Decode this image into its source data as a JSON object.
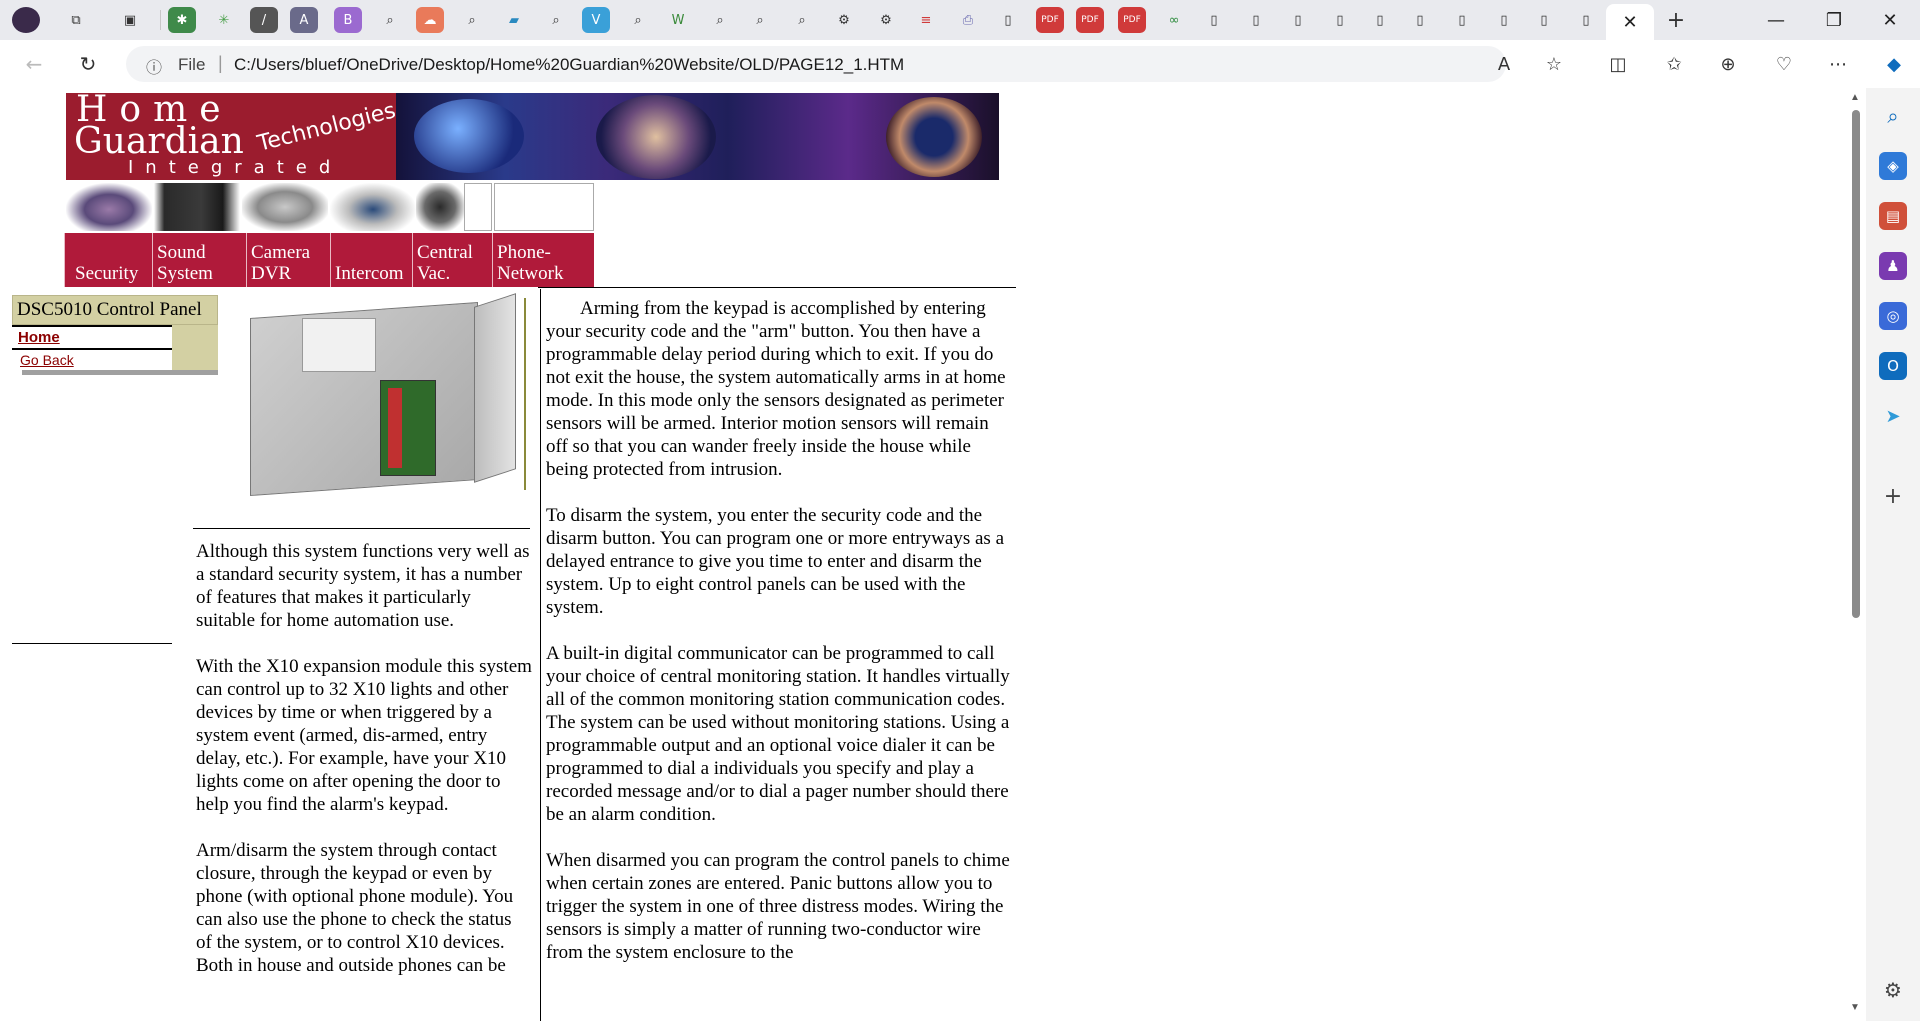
{
  "browser": {
    "window_controls": {
      "minimize": "—",
      "restore": "❐",
      "close": "✕"
    },
    "active_tab_close": "✕",
    "new_tab": "+",
    "address": {
      "info_icon": "ⓘ",
      "scheme_label": "File",
      "url": "C:/Users/bluef/OneDrive/Desktop/Home%20Guardian%20Website/OLD/PAGE12_1.HTM"
    },
    "accent": "#0f6cbd"
  },
  "banner": {
    "home": "Home",
    "guardian": "Guardian",
    "technologies": "Technologies",
    "integrated": "Integrated"
  },
  "nav": {
    "items": [
      {
        "line1": "",
        "line2": "Security"
      },
      {
        "line1": "Sound",
        "line2": "System"
      },
      {
        "line1": "Camera",
        "line2": "DVR"
      },
      {
        "line1": "",
        "line2": "Intercom"
      },
      {
        "line1": "Central",
        "line2": "Vac."
      },
      {
        "line1": "Phone-",
        "line2": "Network"
      }
    ],
    "color": "#b01a3a"
  },
  "sidebar": {
    "title": "DSC5010 Control Panel",
    "home_link": "Home",
    "back_link": "Go Back"
  },
  "content": {
    "left_paragraphs": [
      "Although this system functions very well as a standard security system, it has a number of features that makes it particularly suitable for home automation use.",
      "With the X10 expansion module this system can control up to 32 X10 lights and other devices by time or when triggered by a system event (armed, dis-armed, entry delay, etc.). For example, have your X10 lights come on after opening the door to help you find the alarm's keypad.",
      "Arm/disarm the system through contact closure, through the keypad or even by phone (with optional phone module). You can also use the phone to check the status of the system, or to control X10 devices. Both in house and outside phones can be"
    ],
    "right_paragraphs": [
      "Arming from the keypad is accomplished by entering your security code and the \"arm\" button. You then have a programmable delay period during which to exit. If you do not exit the house, the system automatically arms in at home mode. In this mode only the sensors designated as perimeter sensors will be armed. Interior motion sensors will remain off so that you can wander freely inside the house while being protected from intrusion.",
      "To disarm the system, you enter the security code and the disarm button. You can program one or more entryways as a delayed entrance to give you time to enter and disarm the system. Up to eight control panels can be used with the system.",
      "A built-in digital communicator can be programmed to call your choice of central monitoring station. It handles virtually all of the common monitoring station communication codes. The system can be used without monitoring stations. Using a programmable output and an optional voice dialer it can be programmed to dial a individuals you specify and play a recorded message and/or to dial a pager number should there be an alarm condition.",
      "When disarmed you can program the control panels to chime when certain zones are entered. Panic buttons allow you to trigger the system in one of three distress modes. Wiring the sensors is simply a matter of running two-conductor wire from the system enclosure to the"
    ]
  }
}
